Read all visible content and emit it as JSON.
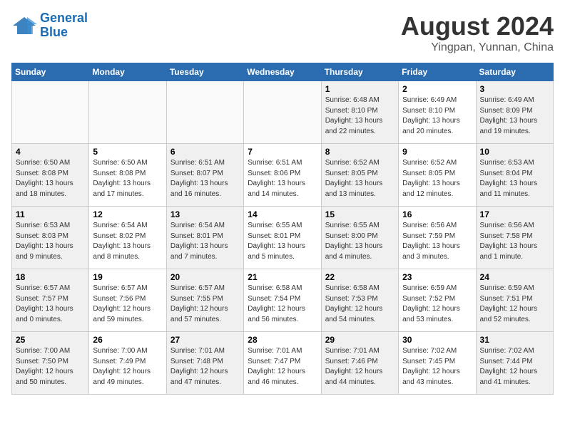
{
  "logo": {
    "line1": "General",
    "line2": "Blue"
  },
  "title": "August 2024",
  "location": "Yingpan, Yunnan, China",
  "days_of_week": [
    "Sunday",
    "Monday",
    "Tuesday",
    "Wednesday",
    "Thursday",
    "Friday",
    "Saturday"
  ],
  "weeks": [
    [
      {
        "day": "",
        "info": ""
      },
      {
        "day": "",
        "info": ""
      },
      {
        "day": "",
        "info": ""
      },
      {
        "day": "",
        "info": ""
      },
      {
        "day": "1",
        "info": "Sunrise: 6:48 AM\nSunset: 8:10 PM\nDaylight: 13 hours\nand 22 minutes."
      },
      {
        "day": "2",
        "info": "Sunrise: 6:49 AM\nSunset: 8:10 PM\nDaylight: 13 hours\nand 20 minutes."
      },
      {
        "day": "3",
        "info": "Sunrise: 6:49 AM\nSunset: 8:09 PM\nDaylight: 13 hours\nand 19 minutes."
      }
    ],
    [
      {
        "day": "4",
        "info": "Sunrise: 6:50 AM\nSunset: 8:08 PM\nDaylight: 13 hours\nand 18 minutes."
      },
      {
        "day": "5",
        "info": "Sunrise: 6:50 AM\nSunset: 8:08 PM\nDaylight: 13 hours\nand 17 minutes."
      },
      {
        "day": "6",
        "info": "Sunrise: 6:51 AM\nSunset: 8:07 PM\nDaylight: 13 hours\nand 16 minutes."
      },
      {
        "day": "7",
        "info": "Sunrise: 6:51 AM\nSunset: 8:06 PM\nDaylight: 13 hours\nand 14 minutes."
      },
      {
        "day": "8",
        "info": "Sunrise: 6:52 AM\nSunset: 8:05 PM\nDaylight: 13 hours\nand 13 minutes."
      },
      {
        "day": "9",
        "info": "Sunrise: 6:52 AM\nSunset: 8:05 PM\nDaylight: 13 hours\nand 12 minutes."
      },
      {
        "day": "10",
        "info": "Sunrise: 6:53 AM\nSunset: 8:04 PM\nDaylight: 13 hours\nand 11 minutes."
      }
    ],
    [
      {
        "day": "11",
        "info": "Sunrise: 6:53 AM\nSunset: 8:03 PM\nDaylight: 13 hours\nand 9 minutes."
      },
      {
        "day": "12",
        "info": "Sunrise: 6:54 AM\nSunset: 8:02 PM\nDaylight: 13 hours\nand 8 minutes."
      },
      {
        "day": "13",
        "info": "Sunrise: 6:54 AM\nSunset: 8:01 PM\nDaylight: 13 hours\nand 7 minutes."
      },
      {
        "day": "14",
        "info": "Sunrise: 6:55 AM\nSunset: 8:01 PM\nDaylight: 13 hours\nand 5 minutes."
      },
      {
        "day": "15",
        "info": "Sunrise: 6:55 AM\nSunset: 8:00 PM\nDaylight: 13 hours\nand 4 minutes."
      },
      {
        "day": "16",
        "info": "Sunrise: 6:56 AM\nSunset: 7:59 PM\nDaylight: 13 hours\nand 3 minutes."
      },
      {
        "day": "17",
        "info": "Sunrise: 6:56 AM\nSunset: 7:58 PM\nDaylight: 13 hours\nand 1 minute."
      }
    ],
    [
      {
        "day": "18",
        "info": "Sunrise: 6:57 AM\nSunset: 7:57 PM\nDaylight: 13 hours\nand 0 minutes."
      },
      {
        "day": "19",
        "info": "Sunrise: 6:57 AM\nSunset: 7:56 PM\nDaylight: 12 hours\nand 59 minutes."
      },
      {
        "day": "20",
        "info": "Sunrise: 6:57 AM\nSunset: 7:55 PM\nDaylight: 12 hours\nand 57 minutes."
      },
      {
        "day": "21",
        "info": "Sunrise: 6:58 AM\nSunset: 7:54 PM\nDaylight: 12 hours\nand 56 minutes."
      },
      {
        "day": "22",
        "info": "Sunrise: 6:58 AM\nSunset: 7:53 PM\nDaylight: 12 hours\nand 54 minutes."
      },
      {
        "day": "23",
        "info": "Sunrise: 6:59 AM\nSunset: 7:52 PM\nDaylight: 12 hours\nand 53 minutes."
      },
      {
        "day": "24",
        "info": "Sunrise: 6:59 AM\nSunset: 7:51 PM\nDaylight: 12 hours\nand 52 minutes."
      }
    ],
    [
      {
        "day": "25",
        "info": "Sunrise: 7:00 AM\nSunset: 7:50 PM\nDaylight: 12 hours\nand 50 minutes."
      },
      {
        "day": "26",
        "info": "Sunrise: 7:00 AM\nSunset: 7:49 PM\nDaylight: 12 hours\nand 49 minutes."
      },
      {
        "day": "27",
        "info": "Sunrise: 7:01 AM\nSunset: 7:48 PM\nDaylight: 12 hours\nand 47 minutes."
      },
      {
        "day": "28",
        "info": "Sunrise: 7:01 AM\nSunset: 7:47 PM\nDaylight: 12 hours\nand 46 minutes."
      },
      {
        "day": "29",
        "info": "Sunrise: 7:01 AM\nSunset: 7:46 PM\nDaylight: 12 hours\nand 44 minutes."
      },
      {
        "day": "30",
        "info": "Sunrise: 7:02 AM\nSunset: 7:45 PM\nDaylight: 12 hours\nand 43 minutes."
      },
      {
        "day": "31",
        "info": "Sunrise: 7:02 AM\nSunset: 7:44 PM\nDaylight: 12 hours\nand 41 minutes."
      }
    ]
  ]
}
